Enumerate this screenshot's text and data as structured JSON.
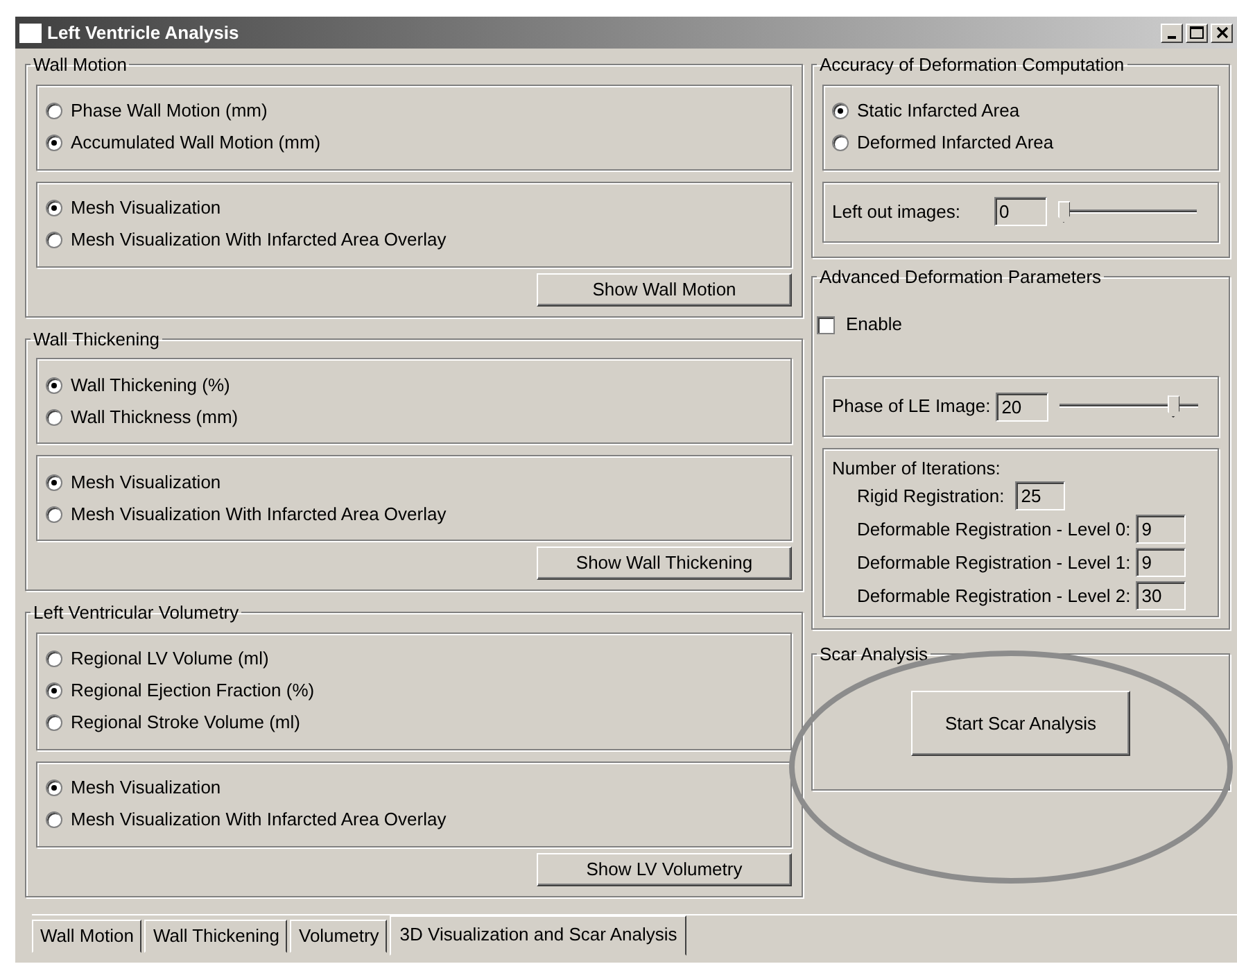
{
  "window": {
    "title": "Left Ventricle Analysis"
  },
  "left_groups": [
    {
      "title": "Wall Motion",
      "option_sets": [
        [
          {
            "label": "Phase Wall Motion (mm)",
            "selected": false
          },
          {
            "label": "Accumulated Wall Motion (mm)",
            "selected": true
          }
        ],
        [
          {
            "label": "Mesh Visualization",
            "selected": true
          },
          {
            "label": "Mesh Visualization With Infarcted Area Overlay",
            "selected": false
          }
        ]
      ],
      "button": "Show Wall Motion"
    },
    {
      "title": "Wall Thickening",
      "option_sets": [
        [
          {
            "label": "Wall Thickening (%)",
            "selected": true
          },
          {
            "label": "Wall Thickness (mm)",
            "selected": false
          }
        ],
        [
          {
            "label": "Mesh Visualization",
            "selected": true
          },
          {
            "label": "Mesh Visualization With Infarcted Area Overlay",
            "selected": false
          }
        ]
      ],
      "button": "Show Wall Thickening"
    },
    {
      "title": "Left Ventricular Volumetry",
      "option_sets": [
        [
          {
            "label": "Regional LV Volume (ml)",
            "selected": false
          },
          {
            "label": "Regional Ejection Fraction (%)",
            "selected": true
          },
          {
            "label": "Regional Stroke Volume (ml)",
            "selected": false
          }
        ],
        [
          {
            "label": "Mesh Visualization",
            "selected": true
          },
          {
            "label": "Mesh Visualization With Infarcted Area Overlay",
            "selected": false
          }
        ]
      ],
      "button": "Show LV Volumetry"
    }
  ],
  "accuracy": {
    "title": "Accuracy of Deformation Computation",
    "options": [
      {
        "label": "Static Infarcted Area",
        "selected": true
      },
      {
        "label": "Deformed Infarcted Area",
        "selected": false
      }
    ],
    "left_out_images": {
      "label": "Left out images:",
      "value": "0",
      "level": 0
    }
  },
  "advanced": {
    "title": "Advanced Deformation Parameters",
    "enable": {
      "label": "Enable",
      "checked": false
    },
    "phase": {
      "label": "Phase of LE Image:",
      "value": "20",
      "level": 0.85
    },
    "iterations": {
      "title": "Number of Iterations:",
      "rows": [
        {
          "label": "Rigid Registration:",
          "value": "25"
        },
        {
          "label": "Deformable Registration - Level 0:",
          "value": "9"
        },
        {
          "label": "Deformable Registration - Level 1:",
          "value": "9"
        },
        {
          "label": "Deformable Registration - Level 2:",
          "value": "30"
        }
      ]
    }
  },
  "scar": {
    "title": "Scar Analysis",
    "button": "Start Scar Analysis"
  },
  "tabs": [
    {
      "label": "Wall Motion",
      "selected": false
    },
    {
      "label": "Wall Thickening",
      "selected": false
    },
    {
      "label": "Volumetry",
      "selected": false
    },
    {
      "label": "3D Visualization and Scar Analysis",
      "selected": true
    }
  ]
}
